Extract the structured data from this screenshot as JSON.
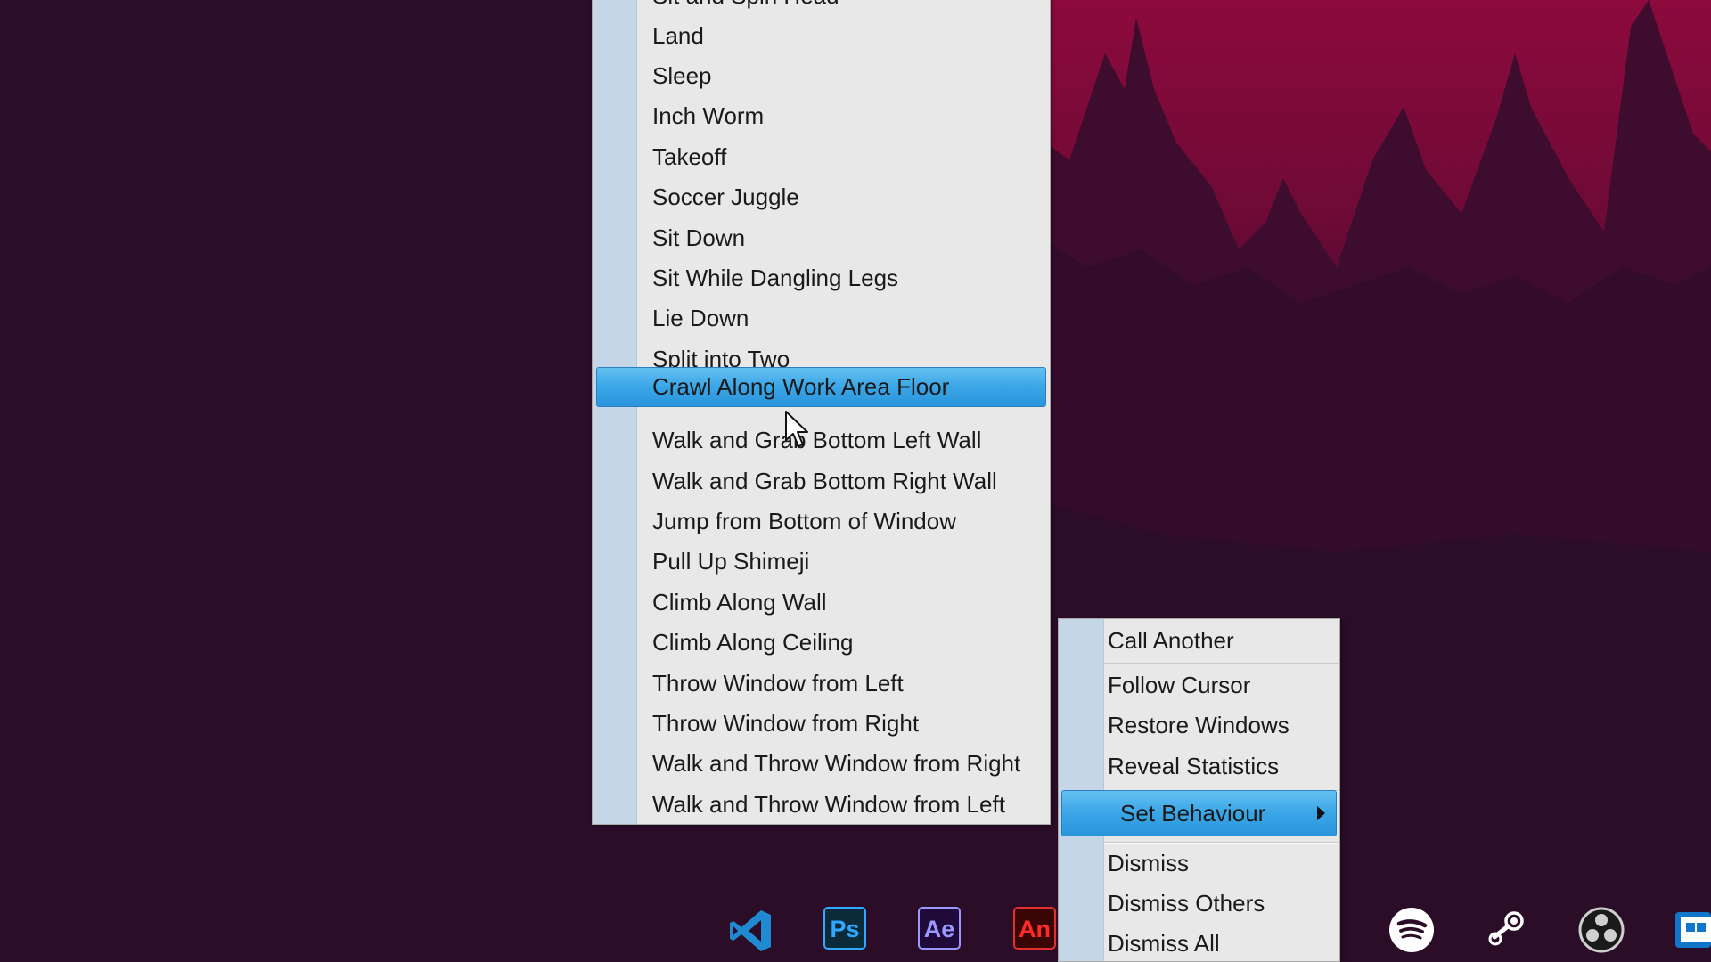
{
  "behaviour_menu": {
    "partial_top_item": "Sit and Spin Head",
    "items": [
      {
        "label": "Land"
      },
      {
        "label": "Sleep"
      },
      {
        "label": "Inch Worm"
      },
      {
        "label": "Takeoff"
      },
      {
        "label": "Soccer Juggle"
      },
      {
        "label": "Sit Down"
      },
      {
        "label": "Sit While Dangling Legs"
      },
      {
        "label": "Lie Down"
      },
      {
        "label": "Split into Two"
      },
      {
        "label": "Crawl Along Work Area Floor",
        "selected": true
      },
      {
        "label": "Walk and Grab Bottom Left Wall"
      },
      {
        "label": "Walk and Grab Bottom Right Wall"
      },
      {
        "label": "Jump from Bottom of Window"
      },
      {
        "label": "Pull Up Shimeji"
      },
      {
        "label": "Climb Along Wall"
      },
      {
        "label": "Climb Along Ceiling"
      },
      {
        "label": "Throw Window from Left"
      },
      {
        "label": "Throw Window from Right"
      },
      {
        "label": "Walk and Throw Window from Right"
      },
      {
        "label": "Walk and Throw Window from Left"
      }
    ]
  },
  "context_menu": {
    "call_another": "Call Another",
    "follow_cursor": "Follow Cursor",
    "restore_windows": "Restore Windows",
    "reveal_statistics": "Reveal Statistics",
    "set_behaviour": "Set Behaviour",
    "dismiss": "Dismiss",
    "dismiss_others": "Dismiss Others",
    "dismiss_all": "Dismiss All"
  },
  "taskbar": {
    "apps": [
      {
        "icon": "vscode-icon"
      },
      {
        "icon": "photoshop-icon",
        "text": "Ps"
      },
      {
        "icon": "after-effects-icon",
        "text": "Ae"
      },
      {
        "icon": "animate-icon",
        "text": "An"
      }
    ],
    "tray": [
      "spotify-icon",
      "steam-icon",
      "obs-icon",
      "app-icon"
    ]
  },
  "colors": {
    "wallpaper_dark": "#2b0d27",
    "wallpaper_red": "#8c0a3c",
    "menu_bg": "#e8e8e8",
    "menu_gutter": "#c5d7e6",
    "selection_blue": "#3aa5e6"
  }
}
